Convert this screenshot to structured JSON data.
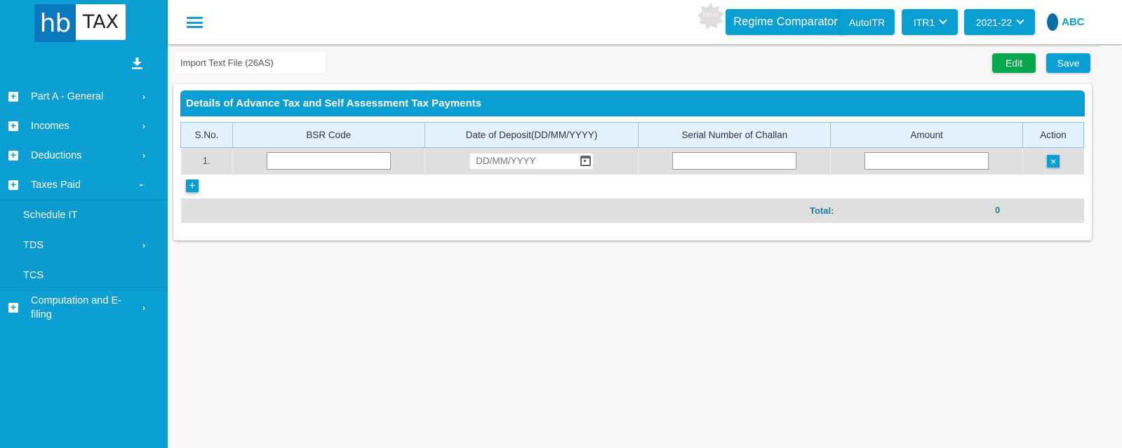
{
  "brand": {
    "logo_left": "hb",
    "logo_right": "TAX"
  },
  "sidebar": {
    "items": [
      {
        "label": "Part A - General",
        "icon": "plus-square-icon",
        "chevron": "chevron-right-icon"
      },
      {
        "label": "Incomes",
        "icon": "plus-square-icon",
        "chevron": "chevron-right-icon"
      },
      {
        "label": "Deductions",
        "icon": "plus-square-icon",
        "chevron": "chevron-right-icon"
      },
      {
        "label": "Taxes Paid",
        "icon": "plus-square-icon",
        "chevron": "chevron-down-icon",
        "expanded": true,
        "children": [
          {
            "label": "Schedule IT"
          },
          {
            "label": "TDS",
            "chevron": "chevron-right-icon"
          },
          {
            "label": "TCS"
          }
        ]
      },
      {
        "label": "Computation and E-filing",
        "icon": "plus-square-icon",
        "chevron": "chevron-right-icon"
      }
    ]
  },
  "header": {
    "menu_icon": "hamburger-icon",
    "new_badge": "New",
    "regime_comparator": "Regime Comparator",
    "autoitr": "AutoITR",
    "itr_select": "ITR1",
    "year_select": "2021-22",
    "user_name": "ABC"
  },
  "toolbar": {
    "import_label": "Import Text File (26AS)",
    "import_icon": "download-icon",
    "edit_label": "Edit",
    "save_label": "Save"
  },
  "section": {
    "title": "Details of Advance Tax and Self Assessment Tax Payments",
    "columns": [
      "S.No.",
      "BSR Code",
      "Date of Deposit(DD/MM/YYYY)",
      "Serial Number of Challan",
      "Amount",
      "Action"
    ],
    "rows": [
      {
        "sno": "1.",
        "bsr_code": "",
        "date_placeholder": "DD/MM/YYYY",
        "challan_serial": "",
        "amount": ""
      }
    ],
    "add_row_icon": "+",
    "delete_icon": "×",
    "total_label": "Total:",
    "total_value": "0"
  },
  "colors": {
    "primary": "#0a9fd3",
    "sidebar": "#0c9fd3",
    "edit_green": "#06a74d",
    "header_row": "#e3f3fd",
    "total_text": "#1b7ea6"
  }
}
